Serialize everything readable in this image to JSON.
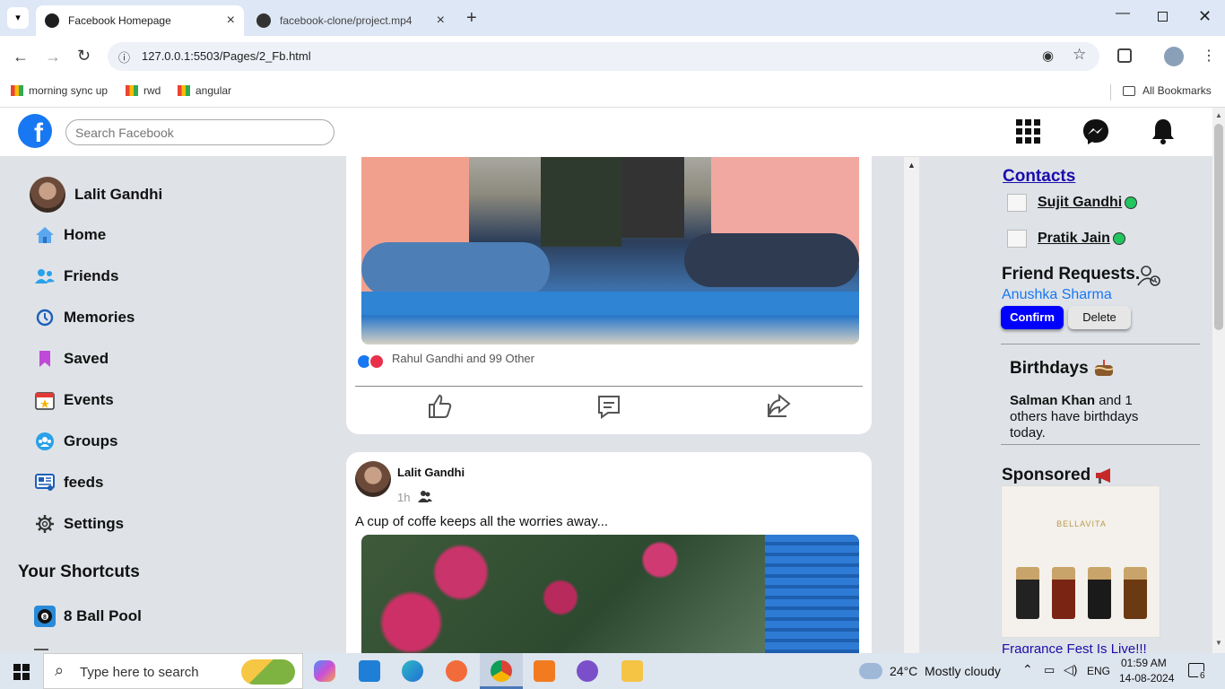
{
  "browser": {
    "tabs": [
      {
        "title": "Facebook Homepage"
      },
      {
        "title": "facebook-clone/project.mp4 at"
      }
    ],
    "url": "127.0.0.1:5503/Pages/2_Fb.html",
    "bookmarks": [
      "morning sync up",
      "rwd",
      "angular"
    ],
    "all_bookmarks": "All Bookmarks"
  },
  "fb": {
    "search_placeholder": "Search Facebook",
    "logo": "f",
    "nav_icons": [
      "home-icon",
      "watch-icon",
      "groups-icon",
      "marketplace-icon",
      "gaming-icon"
    ],
    "right_icons": [
      "menu-grid-icon",
      "messenger-icon",
      "bell-icon"
    ]
  },
  "left": {
    "profile_name": "Lalit Gandhi",
    "items": [
      {
        "label": "Home",
        "icon": "home-icon"
      },
      {
        "label": "Friends",
        "icon": "friends-icon"
      },
      {
        "label": "Memories",
        "icon": "memories-icon"
      },
      {
        "label": "Saved",
        "icon": "saved-icon"
      },
      {
        "label": "Events",
        "icon": "events-icon"
      },
      {
        "label": "Groups",
        "icon": "groups-icon"
      },
      {
        "label": "feeds",
        "icon": "feeds-icon"
      },
      {
        "label": "Settings",
        "icon": "settings-icon"
      }
    ],
    "shortcuts_title": "Your Shortcuts",
    "shortcuts": [
      {
        "label": "8 Ball Pool"
      }
    ]
  },
  "feed": {
    "post1": {
      "reactions_text": "Rahul Gandhi and 99 Other"
    },
    "post2": {
      "author": "Lalit Gandhi",
      "time": "1h",
      "text": "A cup of coffe keeps all the worries away..."
    }
  },
  "right": {
    "contacts_title": "Contacts",
    "contacts": [
      {
        "name": "Sujit Gandhi",
        "status": "online"
      },
      {
        "name": "Pratik Jain",
        "status": "online"
      }
    ],
    "requests_title": "Friend Requests.",
    "request_name": "Anushka Sharma",
    "confirm": "Confirm",
    "delete": "Delete",
    "birthdays_title": "Birthdays",
    "birthday_name": "Salman Khan",
    "birthday_rest": "and 1 others have birthdays today.",
    "sponsored_title": "Sponsored",
    "ad_brand": "BELLAVITA",
    "ad_caption": "Fragrance Fest Is Live!!!"
  },
  "taskbar": {
    "search": "Type here to search",
    "weather": "24°C  Mostly cloudy",
    "lang": "ENG",
    "time": "01:59 AM",
    "date": "14-08-2024",
    "notifications": "6"
  },
  "colors": {
    "fb_blue": "#1877f2",
    "confirm": "#0000ff",
    "online": "#22c55e",
    "link": "#1a0dab"
  }
}
